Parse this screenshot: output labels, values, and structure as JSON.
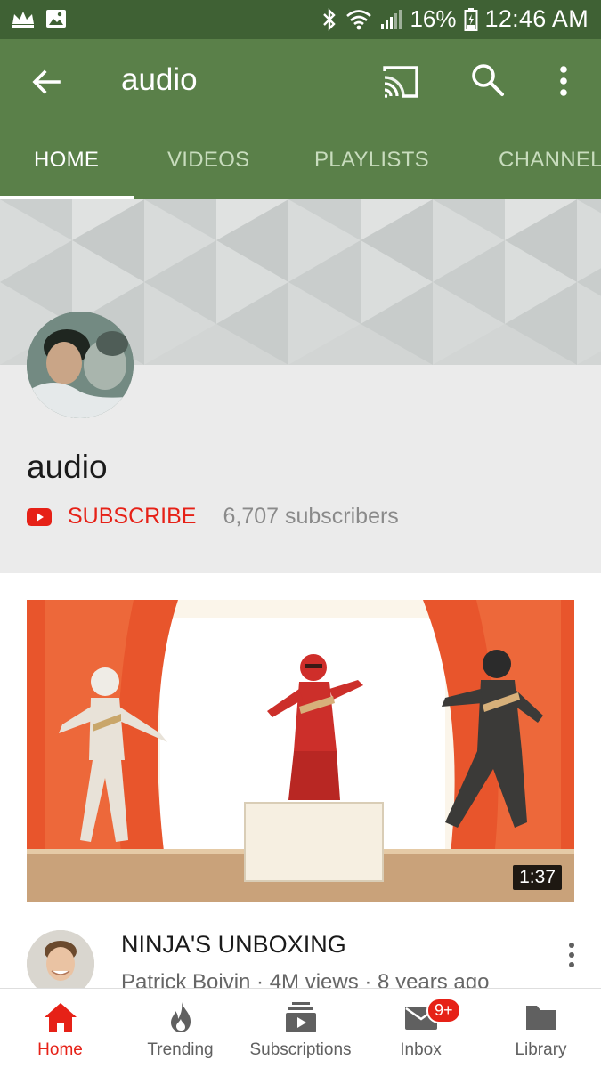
{
  "status_bar": {
    "left_icons": [
      "crown-icon",
      "image-icon"
    ],
    "right_icons": [
      "bluetooth-icon",
      "wifi-icon",
      "signal-icon",
      "battery-icon"
    ],
    "battery_percent": "16%",
    "time": "12:46 AM"
  },
  "app_bar": {
    "title": "audio",
    "icons": [
      "back-arrow-icon",
      "cast-icon",
      "search-icon",
      "more-vert-icon"
    ]
  },
  "tabs": [
    {
      "label": "HOME",
      "active": true
    },
    {
      "label": "VIDEOS",
      "active": false
    },
    {
      "label": "PLAYLISTS",
      "active": false
    },
    {
      "label": "CHANNEL",
      "active": false
    }
  ],
  "channel": {
    "name": "audio",
    "subscribe_label": "SUBSCRIBE",
    "subscriber_count": "6,707 subscribers"
  },
  "video": {
    "duration": "1:37",
    "title": "NINJA'S UNBOXING",
    "meta": "Patrick Boivin · 4M views · 8 years ago"
  },
  "bottom_nav": {
    "items": [
      {
        "label": "Home",
        "icon": "home-icon",
        "active": true
      },
      {
        "label": "Trending",
        "icon": "flame-icon",
        "active": false
      },
      {
        "label": "Subscriptions",
        "icon": "subscriptions-icon",
        "active": false
      },
      {
        "label": "Inbox",
        "icon": "mail-icon",
        "active": false,
        "badge": "9+"
      },
      {
        "label": "Library",
        "icon": "folder-icon",
        "active": false
      }
    ]
  },
  "colors": {
    "status_bar": "#3f6134",
    "app_bar": "#5a8049",
    "accent_red": "#e62117"
  }
}
